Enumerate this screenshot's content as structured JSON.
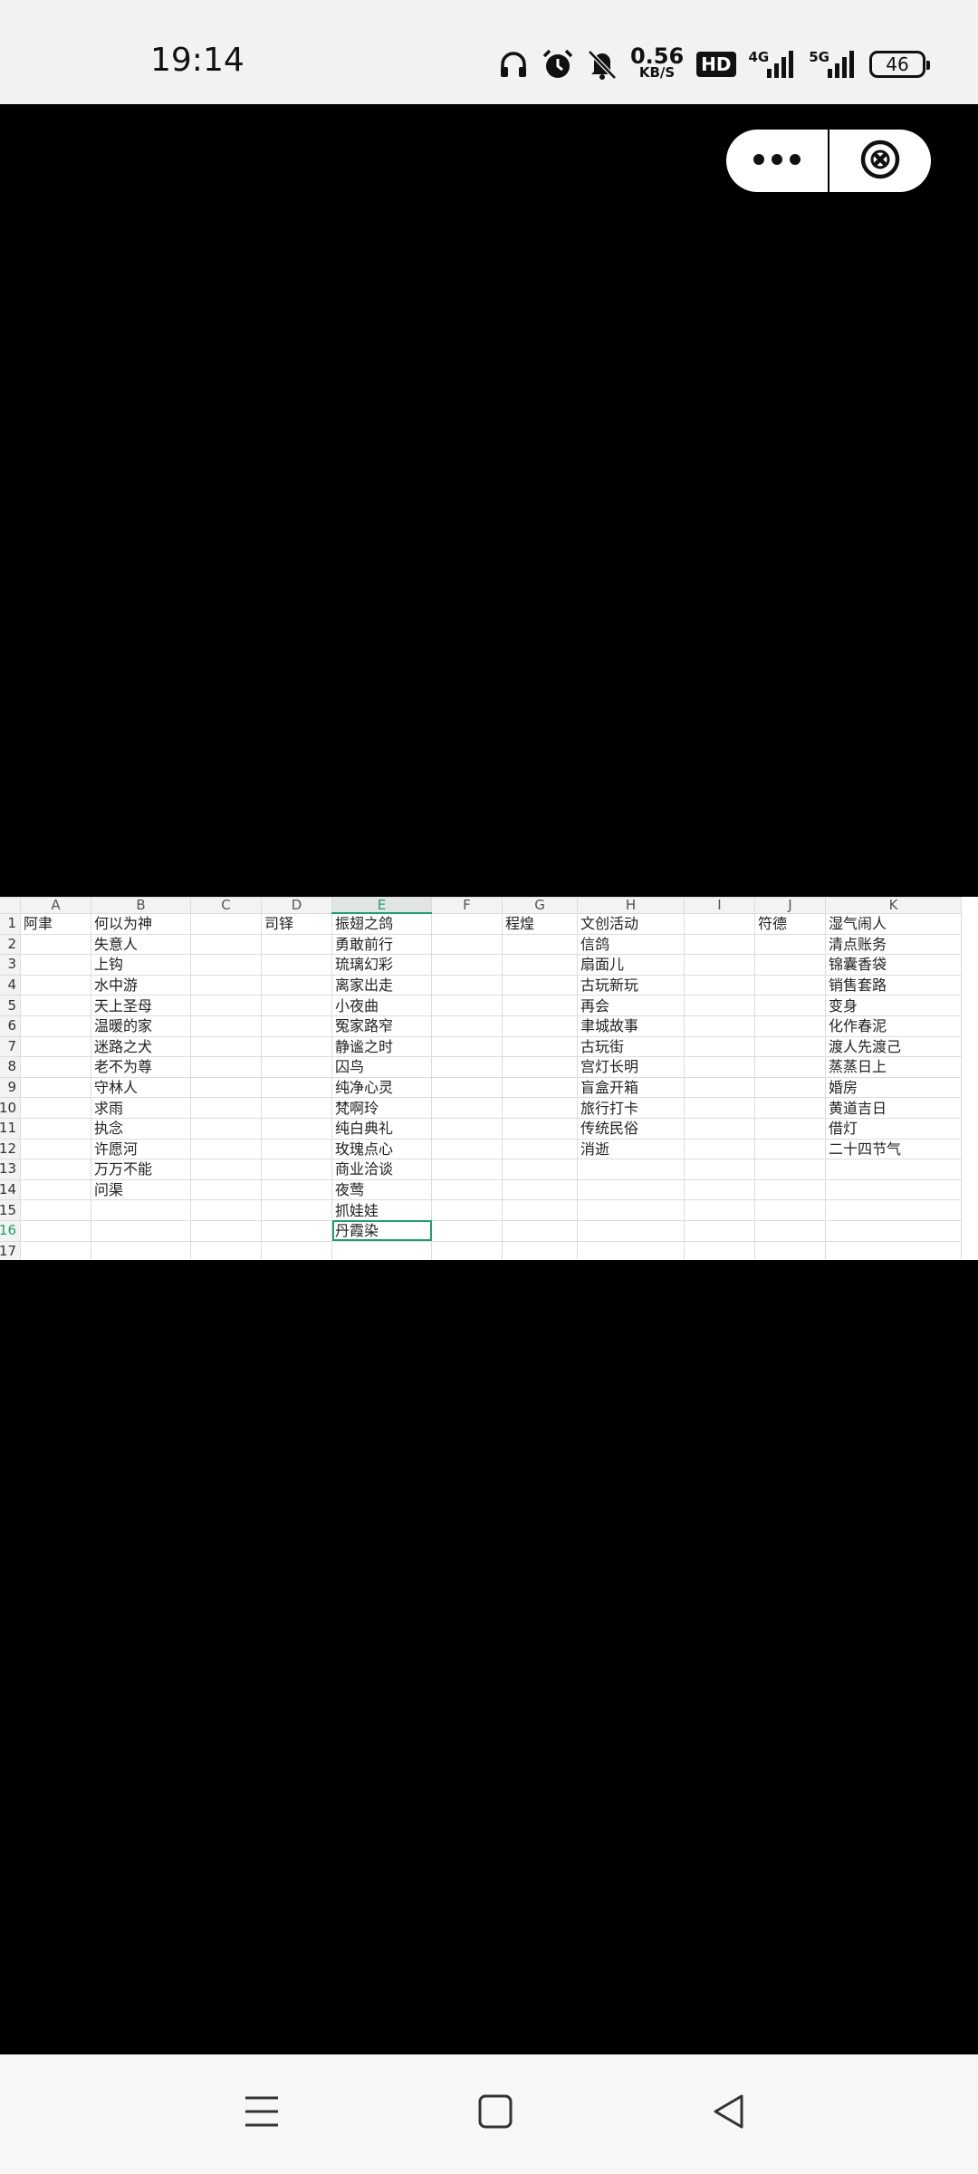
{
  "status_bar": {
    "time": "19:14",
    "net_speed_value": "0.56",
    "net_speed_unit": "KB/S",
    "hd_label": "HD",
    "sim1_label": "4G",
    "sim2_label": "5G",
    "battery": "46",
    "icons": [
      "headphones-icon",
      "alarm-icon",
      "mute-icon",
      "signal-icon",
      "battery-icon"
    ]
  },
  "capsule": {
    "more_icon": "more-dots-icon",
    "close_icon": "close-circle-icon"
  },
  "sheet": {
    "columns": [
      "A",
      "B",
      "C",
      "D",
      "E",
      "F",
      "G",
      "H",
      "I",
      "J",
      "K"
    ],
    "selected_column": "E",
    "selected_row": "16",
    "active_cell_value": "丹霞染",
    "rows": [
      {
        "num": "1",
        "cells": [
          "阿聿",
          "何以为神",
          "",
          "司铎",
          "振翅之鸽",
          "",
          "程煌",
          "文创活动",
          "",
          "符德",
          "湿气闹人"
        ]
      },
      {
        "num": "2",
        "cells": [
          "",
          "失意人",
          "",
          "",
          "勇敢前行",
          "",
          "",
          "信鸽",
          "",
          "",
          "清点账务"
        ]
      },
      {
        "num": "3",
        "cells": [
          "",
          "上钩",
          "",
          "",
          "琉璃幻彩",
          "",
          "",
          "扇面儿",
          "",
          "",
          "锦囊香袋"
        ]
      },
      {
        "num": "4",
        "cells": [
          "",
          "水中游",
          "",
          "",
          "离家出走",
          "",
          "",
          "古玩新玩",
          "",
          "",
          "销售套路"
        ]
      },
      {
        "num": "5",
        "cells": [
          "",
          "天上圣母",
          "",
          "",
          "小夜曲",
          "",
          "",
          "再会",
          "",
          "",
          "变身"
        ]
      },
      {
        "num": "6",
        "cells": [
          "",
          "温暖的家",
          "",
          "",
          "冤家路窄",
          "",
          "",
          "聿城故事",
          "",
          "",
          "化作春泥"
        ]
      },
      {
        "num": "7",
        "cells": [
          "",
          "迷路之犬",
          "",
          "",
          "静谧之时",
          "",
          "",
          "古玩街",
          "",
          "",
          "渡人先渡己"
        ]
      },
      {
        "num": "8",
        "cells": [
          "",
          "老不为尊",
          "",
          "",
          "囚鸟",
          "",
          "",
          "宫灯长明",
          "",
          "",
          "蒸蒸日上"
        ]
      },
      {
        "num": "9",
        "cells": [
          "",
          "守林人",
          "",
          "",
          "纯净心灵",
          "",
          "",
          "盲盒开箱",
          "",
          "",
          "婚房"
        ]
      },
      {
        "num": "10",
        "cells": [
          "",
          "求雨",
          "",
          "",
          "梵啊玲",
          "",
          "",
          "旅行打卡",
          "",
          "",
          "黄道吉日"
        ]
      },
      {
        "num": "11",
        "cells": [
          "",
          "执念",
          "",
          "",
          "纯白典礼",
          "",
          "",
          "传统民俗",
          "",
          "",
          "借灯"
        ]
      },
      {
        "num": "12",
        "cells": [
          "",
          "许愿河",
          "",
          "",
          "玫瑰点心",
          "",
          "",
          "消逝",
          "",
          "",
          "二十四节气"
        ]
      },
      {
        "num": "13",
        "cells": [
          "",
          "万万不能",
          "",
          "",
          "商业洽谈",
          "",
          "",
          "",
          "",
          "",
          ""
        ]
      },
      {
        "num": "14",
        "cells": [
          "",
          "问渠",
          "",
          "",
          "夜莺",
          "",
          "",
          "",
          "",
          "",
          ""
        ]
      },
      {
        "num": "15",
        "cells": [
          "",
          "",
          "",
          "",
          "抓娃娃",
          "",
          "",
          "",
          "",
          "",
          ""
        ]
      },
      {
        "num": "16",
        "cells": [
          "",
          "",
          "",
          "",
          "丹霞染",
          "",
          "",
          "",
          "",
          "",
          ""
        ]
      },
      {
        "num": "17",
        "cells": [
          "",
          "",
          "",
          "",
          "",
          "",
          "",
          "",
          "",
          "",
          ""
        ]
      }
    ]
  },
  "nav_bar": {
    "menu_icon": "menu-icon",
    "home_icon": "home-icon",
    "back_icon": "back-icon"
  }
}
